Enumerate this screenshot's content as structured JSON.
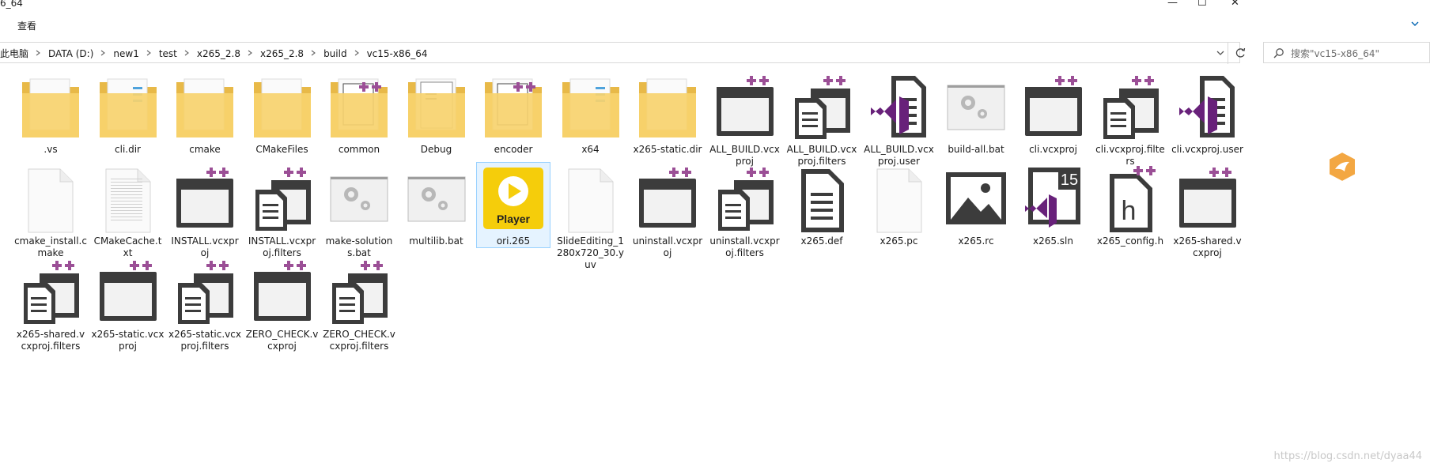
{
  "window": {
    "title": "6_64",
    "controls": [
      "—",
      "☐",
      "✕"
    ]
  },
  "ribbon": {
    "tab": "查看",
    "help_icon": "chevron-down-icon"
  },
  "address": {
    "crumbs": [
      "此电脑",
      "DATA (D:)",
      "new1",
      "test",
      "x265_2.8",
      "x265_2.8",
      "build",
      "vc15-x86_64"
    ]
  },
  "search": {
    "placeholder": "搜索\"vc15-x86_64\""
  },
  "files": [
    {
      "name": ".vs",
      "icon": "folder-icon"
    },
    {
      "name": "cli.dir",
      "icon": "folder-icon"
    },
    {
      "name": "cmake",
      "icon": "folder-icon"
    },
    {
      "name": "CMakeFiles",
      "icon": "folder-icon"
    },
    {
      "name": "common",
      "icon": "folder-icon"
    },
    {
      "name": "Debug",
      "icon": "folder-icon"
    },
    {
      "name": "encoder",
      "icon": "folder-icon"
    },
    {
      "name": "x64",
      "icon": "folder-icon"
    },
    {
      "name": "x265-static.dir",
      "icon": "folder-icon"
    },
    {
      "name": "ALL_BUILD.vcxproj",
      "icon": "vcxproj-icon"
    },
    {
      "name": "ALL_BUILD.vcxproj.filters",
      "icon": "filters-icon"
    },
    {
      "name": "ALL_BUILD.vcxproj.user",
      "icon": "vs-user-icon"
    },
    {
      "name": "build-all.bat",
      "icon": "bat-icon"
    },
    {
      "name": "cli.vcxproj",
      "icon": "vcxproj-icon"
    },
    {
      "name": "cli.vcxproj.filters",
      "icon": "filters-icon"
    },
    {
      "name": "cli.vcxproj.user",
      "icon": "vs-user-icon"
    },
    {
      "name": "cmake_install.cmake",
      "icon": "blank-file-icon"
    },
    {
      "name": "CMakeCache.txt",
      "icon": "text-file-icon"
    },
    {
      "name": "INSTALL.vcxproj",
      "icon": "vcxproj-icon"
    },
    {
      "name": "INSTALL.vcxproj.filters",
      "icon": "filters-icon"
    },
    {
      "name": "make-solutions.bat",
      "icon": "bat-icon"
    },
    {
      "name": "multilib.bat",
      "icon": "bat-icon"
    },
    {
      "name": "ori.265",
      "icon": "player-icon",
      "selected": true
    },
    {
      "name": "SlideEditing_1280x720_30.yuv",
      "icon": "blank-file-icon"
    },
    {
      "name": "uninstall.vcxproj",
      "icon": "vcxproj-icon"
    },
    {
      "name": "uninstall.vcxproj.filters",
      "icon": "filters-icon"
    },
    {
      "name": "x265.def",
      "icon": "doc-icon"
    },
    {
      "name": "x265.pc",
      "icon": "blank-file-icon"
    },
    {
      "name": "x265.rc",
      "icon": "image-icon"
    },
    {
      "name": "x265.sln",
      "icon": "sln-icon"
    },
    {
      "name": "x265_config.h",
      "icon": "header-icon"
    },
    {
      "name": "x265-shared.vcxproj",
      "icon": "vcxproj-icon"
    },
    {
      "name": "x265-shared.vcxproj.filters",
      "icon": "filters-icon"
    },
    {
      "name": "x265-static.vcxproj",
      "icon": "vcxproj-icon"
    },
    {
      "name": "x265-static.vcxproj.filters",
      "icon": "filters-icon"
    },
    {
      "name": "ZERO_CHECK.vcxproj",
      "icon": "vcxproj-icon"
    },
    {
      "name": "ZERO_CHECK.vcxproj.filters",
      "icon": "filters-icon"
    }
  ],
  "player_label": "Player",
  "sln_version": "15",
  "watermark": "https://blog.csdn.net/dyaa44",
  "colors": {
    "folder": "#f7d26e",
    "vs_purple": "#68217a",
    "plus_purple": "#9b4f96",
    "player_yellow": "#f5cd0b",
    "selection": "#cce8ff"
  }
}
